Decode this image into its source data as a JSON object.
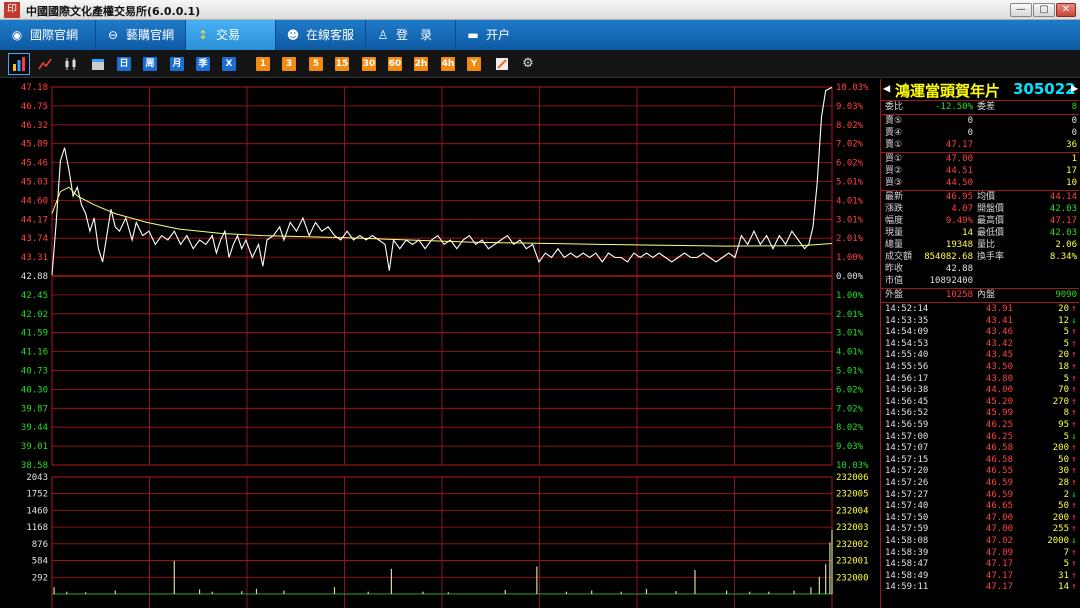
{
  "window": {
    "title": "中國國際文化產權交易所(6.0.0.1)",
    "icon_text": "印",
    "min": "—",
    "max": "▢",
    "close": "✕"
  },
  "nav": [
    {
      "label": "國際官網",
      "icon": "globe-icon",
      "glyph": "◉"
    },
    {
      "label": "藝購官網",
      "icon": "link-icon",
      "glyph": "⊖"
    },
    {
      "label": "交易",
      "icon": "trade-icon",
      "glyph": "↕"
    },
    {
      "label": "在線客服",
      "icon": "chat-icon",
      "glyph": "☻"
    },
    {
      "label": "登　录",
      "icon": "user-icon",
      "glyph": "♙"
    },
    {
      "label": "开户",
      "icon": "card-icon",
      "glyph": "▬"
    }
  ],
  "toolbar": {
    "periods": [
      "日",
      "周",
      "月",
      "季",
      "X"
    ],
    "minutes": [
      "1",
      "3",
      "5",
      "15",
      "30",
      "60",
      "2h",
      "4h",
      "Y"
    ]
  },
  "chart_data": {
    "type": "line",
    "x_range": [
      "09:30",
      "15:00"
    ],
    "price_ticks": [
      "47.18",
      "46.75",
      "46.32",
      "45.89",
      "45.46",
      "45.03",
      "44.60",
      "44.17",
      "43.74",
      "43.31",
      "42.88",
      "42.45",
      "42.02",
      "41.59",
      "41.16",
      "40.73",
      "40.30",
      "39.87",
      "39.44",
      "39.01",
      "38.58"
    ],
    "pct_ticks": [
      "10.03%",
      "9.03%",
      "8.02%",
      "7.02%",
      "6.02%",
      "5.01%",
      "4.01%",
      "3.01%",
      "2.01%",
      "1.00%",
      "0.00%",
      "1.00%",
      "2.01%",
      "3.01%",
      "4.01%",
      "5.01%",
      "6.02%",
      "7.02%",
      "8.02%",
      "9.03%",
      "10.03%"
    ],
    "vol_ticks": [
      "2043",
      "1752",
      "1460",
      "1168",
      "876",
      "584",
      "292"
    ],
    "oi_ticks": [
      "232006",
      "232005",
      "232004",
      "232003",
      "232002",
      "232001",
      "232000"
    ],
    "prev_close": 42.88,
    "ylim": [
      38.58,
      47.18
    ],
    "series": [
      {
        "name": "price",
        "color": "#ffffff",
        "points": [
          [
            0,
            42.9
          ],
          [
            2,
            44.1
          ],
          [
            4,
            45.5
          ],
          [
            6,
            45.8
          ],
          [
            8,
            45.3
          ],
          [
            10,
            44.7
          ],
          [
            12,
            44.9
          ],
          [
            14,
            44.5
          ],
          [
            16,
            44.3
          ],
          [
            18,
            43.9
          ],
          [
            20,
            44.2
          ],
          [
            22,
            43.5
          ],
          [
            24,
            43.2
          ],
          [
            26,
            43.8
          ],
          [
            28,
            44.4
          ],
          [
            30,
            44.0
          ],
          [
            32,
            43.9
          ],
          [
            35,
            44.2
          ],
          [
            38,
            43.7
          ],
          [
            40,
            44.1
          ],
          [
            43,
            43.8
          ],
          [
            46,
            43.9
          ],
          [
            49,
            43.6
          ],
          [
            52,
            43.8
          ],
          [
            55,
            43.7
          ],
          [
            58,
            43.9
          ],
          [
            61,
            43.6
          ],
          [
            64,
            43.8
          ],
          [
            67,
            43.5
          ],
          [
            70,
            43.7
          ],
          [
            73,
            43.6
          ],
          [
            76,
            43.8
          ],
          [
            78,
            43.4
          ],
          [
            80,
            43.7
          ],
          [
            82,
            43.9
          ],
          [
            84,
            43.3
          ],
          [
            86,
            43.6
          ],
          [
            88,
            43.8
          ],
          [
            90,
            43.5
          ],
          [
            92,
            43.7
          ],
          [
            95,
            43.3
          ],
          [
            98,
            43.6
          ],
          [
            100,
            43.1
          ],
          [
            102,
            43.7
          ],
          [
            105,
            43.8
          ],
          [
            108,
            44.0
          ],
          [
            110,
            43.7
          ],
          [
            113,
            44.1
          ],
          [
            116,
            43.9
          ],
          [
            119,
            44.2
          ],
          [
            122,
            43.8
          ],
          [
            125,
            44.1
          ],
          [
            128,
            43.9
          ],
          [
            131,
            44.0
          ],
          [
            134,
            43.8
          ],
          [
            137,
            43.7
          ],
          [
            140,
            43.9
          ],
          [
            143,
            43.7
          ],
          [
            146,
            43.8
          ],
          [
            149,
            43.7
          ],
          [
            152,
            43.8
          ],
          [
            155,
            43.7
          ],
          [
            158,
            43.6
          ],
          [
            160,
            43.0
          ],
          [
            162,
            43.7
          ],
          [
            165,
            43.5
          ],
          [
            168,
            43.7
          ],
          [
            171,
            43.6
          ],
          [
            174,
            43.7
          ],
          [
            177,
            43.5
          ],
          [
            180,
            43.7
          ],
          [
            183,
            43.8
          ],
          [
            186,
            43.6
          ],
          [
            189,
            43.7
          ],
          [
            192,
            43.5
          ],
          [
            195,
            43.7
          ],
          [
            198,
            43.8
          ],
          [
            201,
            43.6
          ],
          [
            204,
            43.7
          ],
          [
            207,
            43.5
          ],
          [
            210,
            43.6
          ],
          [
            213,
            43.7
          ],
          [
            216,
            43.8
          ],
          [
            219,
            43.6
          ],
          [
            222,
            43.7
          ],
          [
            225,
            43.5
          ],
          [
            228,
            43.6
          ],
          [
            231,
            43.2
          ],
          [
            234,
            43.4
          ],
          [
            237,
            43.3
          ],
          [
            240,
            43.5
          ],
          [
            243,
            43.3
          ],
          [
            246,
            43.4
          ],
          [
            249,
            43.3
          ],
          [
            252,
            43.4
          ],
          [
            255,
            43.3
          ],
          [
            258,
            43.4
          ],
          [
            261,
            43.2
          ],
          [
            264,
            43.4
          ],
          [
            267,
            43.3
          ],
          [
            270,
            43.3
          ],
          [
            273,
            43.2
          ],
          [
            276,
            43.4
          ],
          [
            279,
            43.3
          ],
          [
            282,
            43.4
          ],
          [
            285,
            43.3
          ],
          [
            288,
            43.4
          ],
          [
            291,
            43.3
          ],
          [
            294,
            43.2
          ],
          [
            297,
            43.3
          ],
          [
            300,
            43.4
          ],
          [
            303,
            43.3
          ],
          [
            306,
            43.3
          ],
          [
            309,
            43.4
          ],
          [
            312,
            43.3
          ],
          [
            315,
            43.2
          ],
          [
            318,
            43.3
          ],
          [
            321,
            43.4
          ],
          [
            324,
            43.3
          ],
          [
            327,
            43.8
          ],
          [
            330,
            43.6
          ],
          [
            333,
            43.9
          ],
          [
            336,
            43.6
          ],
          [
            339,
            43.8
          ],
          [
            342,
            43.5
          ],
          [
            345,
            43.8
          ],
          [
            348,
            43.6
          ],
          [
            351,
            43.9
          ],
          [
            354,
            43.7
          ],
          [
            357,
            43.5
          ],
          [
            359,
            43.6
          ],
          [
            361,
            44.0
          ],
          [
            363,
            45.0
          ],
          [
            365,
            46.5
          ],
          [
            367,
            47.1
          ],
          [
            370,
            47.17
          ]
        ]
      },
      {
        "name": "avg",
        "color": "#ffff80",
        "points": [
          [
            0,
            44.3
          ],
          [
            4,
            44.8
          ],
          [
            8,
            44.9
          ],
          [
            12,
            44.7
          ],
          [
            20,
            44.5
          ],
          [
            30,
            44.3
          ],
          [
            45,
            44.1
          ],
          [
            60,
            43.95
          ],
          [
            80,
            43.85
          ],
          [
            100,
            43.8
          ],
          [
            140,
            43.75
          ],
          [
            200,
            43.65
          ],
          [
            260,
            43.6
          ],
          [
            320,
            43.56
          ],
          [
            355,
            43.57
          ],
          [
            370,
            43.62
          ]
        ]
      }
    ],
    "volume_bars": [
      [
        1,
        120
      ],
      [
        7,
        40
      ],
      [
        16,
        30
      ],
      [
        30,
        60
      ],
      [
        58,
        580
      ],
      [
        70,
        80
      ],
      [
        76,
        40
      ],
      [
        90,
        50
      ],
      [
        97,
        90
      ],
      [
        110,
        60
      ],
      [
        134,
        120
      ],
      [
        150,
        40
      ],
      [
        161,
        440
      ],
      [
        176,
        40
      ],
      [
        188,
        30
      ],
      [
        215,
        70
      ],
      [
        230,
        480
      ],
      [
        244,
        40
      ],
      [
        256,
        60
      ],
      [
        270,
        40
      ],
      [
        282,
        90
      ],
      [
        296,
        50
      ],
      [
        305,
        420
      ],
      [
        320,
        60
      ],
      [
        331,
        40
      ],
      [
        340,
        40
      ],
      [
        352,
        60
      ],
      [
        360,
        120
      ],
      [
        364,
        300
      ],
      [
        367,
        520
      ],
      [
        369,
        900
      ],
      [
        370,
        1120
      ]
    ]
  },
  "quote": {
    "name": "鴻運當頭賀年片",
    "code": "305022",
    "webi": {
      "label": "委比",
      "value": "-12.50%",
      "label2": "委差",
      "value2": "8"
    },
    "asks": [
      {
        "label": "賣⑤",
        "price": "0",
        "vol": "0"
      },
      {
        "label": "賣④",
        "price": "0",
        "vol": "0"
      },
      {
        "label": "賣①",
        "price": "47.17",
        "vol": "36"
      }
    ],
    "bids": [
      {
        "label": "買①",
        "price": "47.00",
        "vol": "1"
      },
      {
        "label": "買②",
        "price": "44.51",
        "vol": "17"
      },
      {
        "label": "買③",
        "price": "44.50",
        "vol": "10"
      }
    ],
    "stats": [
      {
        "label": "最新",
        "value": "46.95",
        "label2": "均價",
        "value2": "44.14"
      },
      {
        "label": "漲跌",
        "value": "4.07",
        "label2": "開盤價",
        "value2": "42.03"
      },
      {
        "label": "幅度",
        "value": "9.49%",
        "label2": "最高價",
        "value2": "47.17"
      },
      {
        "label": "現量",
        "value": "14",
        "label2": "最低價",
        "value2": "42.03"
      },
      {
        "label": "總量",
        "value": "19348",
        "label2": "量比",
        "value2": "2.06"
      },
      {
        "label": "成交額",
        "value": "854082.68",
        "label2": "換手率",
        "value2": "8.34%"
      },
      {
        "label": "昨收",
        "value": "42.88",
        "label2": "",
        "value2": ""
      },
      {
        "label": "市值",
        "value": "10892400",
        "label2": "",
        "value2": ""
      }
    ],
    "outer": {
      "label": "外盤",
      "value": "10258",
      "label2": "內盤",
      "value2": "9090"
    }
  },
  "ticks": [
    {
      "time": "14:52:14",
      "price": "43.91",
      "vol": "20",
      "dir": "↑"
    },
    {
      "time": "14:53:35",
      "price": "43.41",
      "vol": "12",
      "dir": "↓"
    },
    {
      "time": "14:54:09",
      "price": "43.46",
      "vol": "5",
      "dir": "↑"
    },
    {
      "time": "14:54:53",
      "price": "43.42",
      "vol": "5",
      "dir": "↑"
    },
    {
      "time": "14:55:40",
      "price": "43.45",
      "vol": "20",
      "dir": "↑"
    },
    {
      "time": "14:55:56",
      "price": "43.50",
      "vol": "18",
      "dir": "↑"
    },
    {
      "time": "14:56:17",
      "price": "43.80",
      "vol": "5",
      "dir": "↑"
    },
    {
      "time": "14:56:38",
      "price": "44.00",
      "vol": "70",
      "dir": "↑"
    },
    {
      "time": "14:56:45",
      "price": "45.20",
      "vol": "270",
      "dir": "↑"
    },
    {
      "time": "14:56:52",
      "price": "45.99",
      "vol": "8",
      "dir": "↑"
    },
    {
      "time": "14:56:59",
      "price": "46.25",
      "vol": "95",
      "dir": "↑"
    },
    {
      "time": "14:57:00",
      "price": "46.25",
      "vol": "5",
      "dir": "↓"
    },
    {
      "time": "14:57:07",
      "price": "46.58",
      "vol": "200",
      "dir": "↑"
    },
    {
      "time": "14:57:15",
      "price": "46.58",
      "vol": "50",
      "dir": "↑"
    },
    {
      "time": "14:57:20",
      "price": "46.55",
      "vol": "30",
      "dir": "↑"
    },
    {
      "time": "14:57:26",
      "price": "46.59",
      "vol": "28",
      "dir": "↑"
    },
    {
      "time": "14:57:27",
      "price": "46.59",
      "vol": "2",
      "dir": "↓"
    },
    {
      "time": "14:57:40",
      "price": "46.65",
      "vol": "50",
      "dir": "↑"
    },
    {
      "time": "14:57:50",
      "price": "47.00",
      "vol": "200",
      "dir": "↑"
    },
    {
      "time": "14:57:59",
      "price": "47.00",
      "vol": "255",
      "dir": "↑"
    },
    {
      "time": "14:58:08",
      "price": "47.02",
      "vol": "2000",
      "dir": "↓"
    },
    {
      "time": "14:58:39",
      "price": "47.09",
      "vol": "7",
      "dir": "↑"
    },
    {
      "time": "14:58:47",
      "price": "47.17",
      "vol": "5",
      "dir": "↑"
    },
    {
      "time": "14:58:49",
      "price": "47.17",
      "vol": "31",
      "dir": "↑"
    },
    {
      "time": "14:59:11",
      "price": "47.17",
      "vol": "14",
      "dir": "↑"
    }
  ]
}
